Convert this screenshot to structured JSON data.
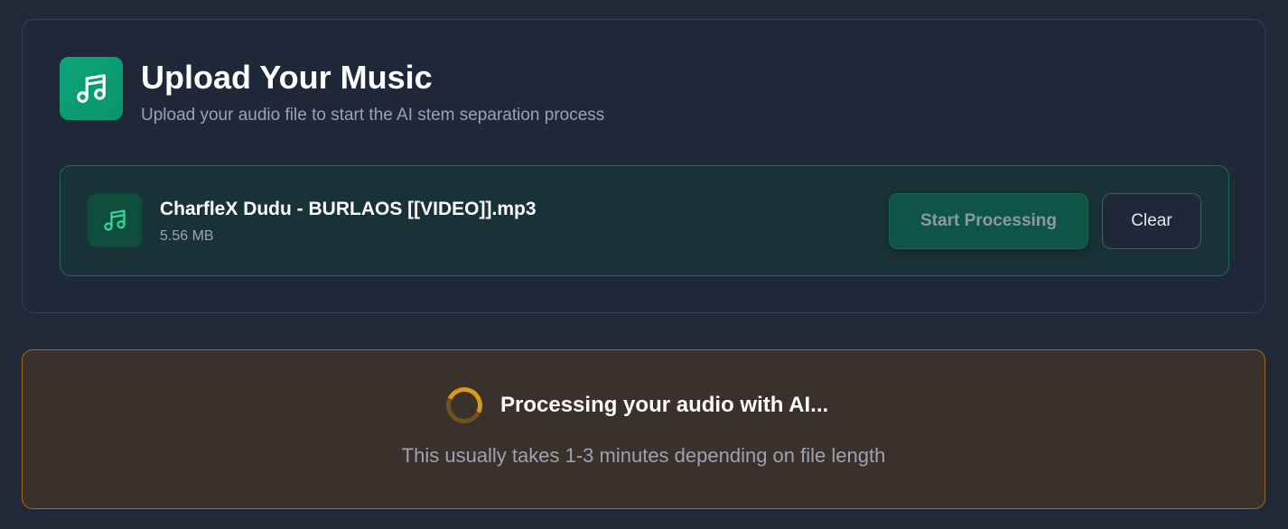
{
  "upload": {
    "title": "Upload Your Music",
    "subtitle": "Upload your audio file to start the AI stem separation process",
    "header_icon": "music-note-icon"
  },
  "file": {
    "name": "CharfleX Dudu - BURLAOS [[VIDEO]].mp3",
    "size": "5.56 MB",
    "icon": "music-note-icon",
    "start_label": "Start Processing",
    "clear_label": "Clear"
  },
  "processing": {
    "title": "Processing your audio with AI...",
    "note": "This usually takes 1-3 minutes depending on file length",
    "spinner_icon": "loading-spinner-icon"
  },
  "colors": {
    "accent": "#059669",
    "warning": "#d99a1a",
    "background": "#1f2937"
  }
}
